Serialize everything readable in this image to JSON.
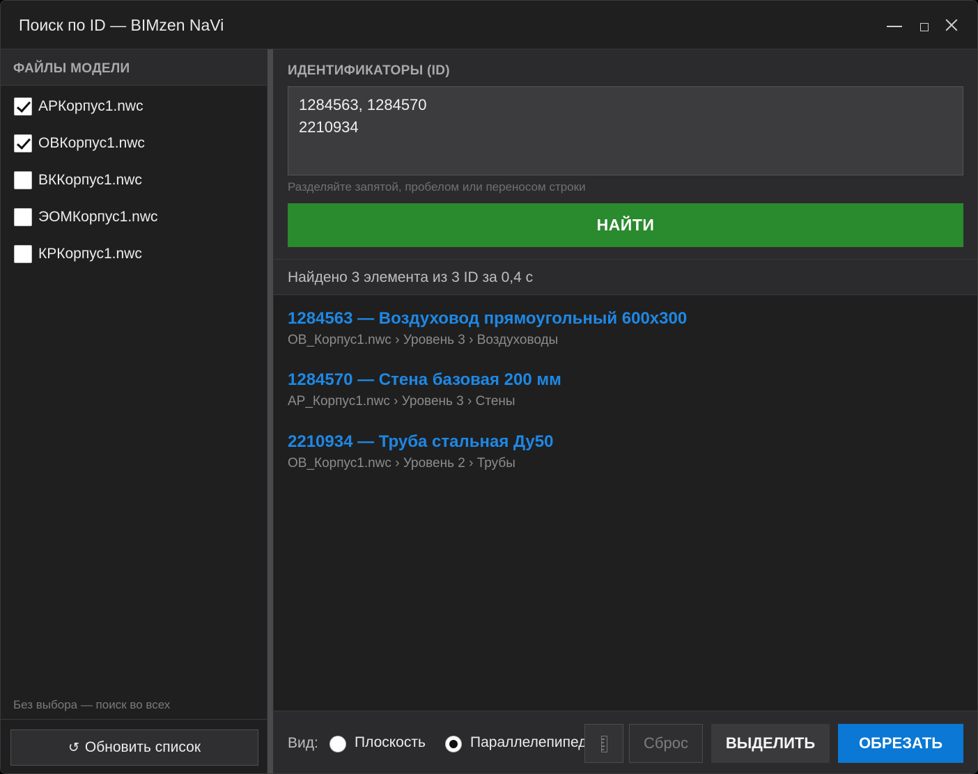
{
  "window": {
    "title": "Поиск по ID — BIMzen NaVi"
  },
  "sidebar": {
    "header": "ФАЙЛЫ МОДЕЛИ",
    "files": [
      {
        "name": "АРКорпус1.nwc",
        "checked": true
      },
      {
        "name": "ОВКорпус1.nwc",
        "checked": true
      },
      {
        "name": "ВККорпус1.nwc",
        "checked": false
      },
      {
        "name": "ЭОМКорпус1.nwc",
        "checked": false
      },
      {
        "name": "КРКорпус1.nwc",
        "checked": false
      }
    ],
    "hint": "Без выбора — поиск во всех",
    "refresh_icon": "↺",
    "refresh_label": "Обновить список"
  },
  "search": {
    "header": "ИДЕНТИФИКАТОРЫ (ID)",
    "value": "1284563, 1284570\n2210934",
    "hint": "Разделяйте запятой, пробелом или переносом строки",
    "find_label": "НАЙТИ"
  },
  "status": {
    "text": "Найдено 3 элемента из 3 ID за 0,4 с"
  },
  "results": [
    {
      "title": "1284563 — Воздуховод прямоугольный 600x300",
      "path": "ОВ_Корпус1.nwc › Уровень 3 › Воздуховоды"
    },
    {
      "title": "1284570 — Стена базовая 200 мм",
      "path": "АР_Корпус1.nwc › Уровень 3 › Стены"
    },
    {
      "title": "2210934 — Труба стальная Ду50",
      "path": "ОВ_Корпус1.nwc › Уровень 2 › Трубы"
    }
  ],
  "bottom": {
    "view_label": "Вид:",
    "options": [
      {
        "label": "Плоскость",
        "selected": false
      },
      {
        "label": "Параллелепипед",
        "selected": true
      }
    ],
    "ruler_icon": "ruler-icon",
    "reset_label": "Сброс",
    "select_label": "ВЫДЕЛИТЬ",
    "crop_label": "ОБРЕЗАТЬ"
  },
  "colors": {
    "accent_green": "#2a8a2e",
    "accent_blue": "#0a78d4",
    "link_blue": "#1e88e5"
  }
}
